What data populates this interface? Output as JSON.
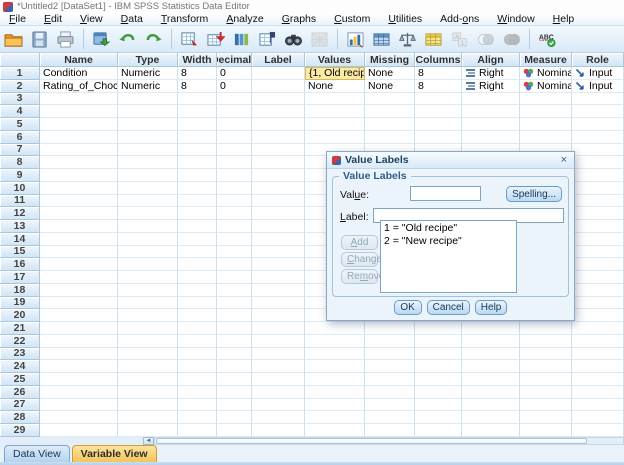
{
  "window": {
    "title": "*Untitled2 [DataSet1] - IBM SPSS Statistics Data Editor"
  },
  "menu": {
    "items": [
      {
        "label": "File",
        "underline": 0
      },
      {
        "label": "Edit",
        "underline": 0
      },
      {
        "label": "View",
        "underline": 0
      },
      {
        "label": "Data",
        "underline": 0
      },
      {
        "label": "Transform",
        "underline": 0
      },
      {
        "label": "Analyze",
        "underline": 0
      },
      {
        "label": "Graphs",
        "underline": 0
      },
      {
        "label": "Custom",
        "underline": 0
      },
      {
        "label": "Utilities",
        "underline": 0
      },
      {
        "label": "Add-ons",
        "underline": 4
      },
      {
        "label": "Window",
        "underline": 0
      },
      {
        "label": "Help",
        "underline": 0
      }
    ]
  },
  "toolbar": {
    "icons": [
      {
        "name": "open-data-icon",
        "disabled": false
      },
      {
        "name": "save-icon",
        "disabled": false
      },
      {
        "name": "print-icon",
        "disabled": false
      },
      {
        "name": "recall-dialogs-icon",
        "disabled": false
      },
      {
        "name": "undo-icon",
        "disabled": false
      },
      {
        "name": "redo-icon",
        "disabled": false
      },
      {
        "name": "goto-case-icon",
        "disabled": false
      },
      {
        "name": "insert-cases-icon",
        "disabled": false
      },
      {
        "name": "goto-variable-icon",
        "disabled": false
      },
      {
        "name": "insert-variable-icon",
        "disabled": false
      },
      {
        "name": "find-icon",
        "disabled": false
      },
      {
        "name": "split-file-icon",
        "disabled": true
      },
      {
        "name": "chart-builder-icon",
        "disabled": false
      },
      {
        "name": "value-labels-grid-icon",
        "disabled": false
      },
      {
        "name": "weigh-cases-icon",
        "disabled": false
      },
      {
        "name": "select-cases-icon",
        "disabled": false
      },
      {
        "name": "value-labels-toggle-icon",
        "disabled": true
      },
      {
        "name": "use-variable-sets-icon",
        "disabled": true
      },
      {
        "name": "show-all-variables-icon",
        "disabled": true
      },
      {
        "name": "spell-check-icon",
        "disabled": false
      }
    ]
  },
  "grid": {
    "columns": [
      "",
      "Name",
      "Type",
      "Width",
      "Decimals",
      "Label",
      "Values",
      "Missing",
      "Columns",
      "Align",
      "Measure",
      "Role"
    ],
    "row_count": 29,
    "rows": [
      {
        "num": "1",
        "name": "Condition",
        "type": "Numeric",
        "width": "8",
        "decimals": "0",
        "label": "",
        "values": "{1, Old recip...",
        "values_selected": true,
        "missing": "None",
        "columns": "8",
        "align": "Right",
        "measure": "Nominal",
        "role": "Input"
      },
      {
        "num": "2",
        "name": "Rating_of_Chocolate",
        "type": "Numeric",
        "width": "8",
        "decimals": "0",
        "label": "",
        "values": "None",
        "values_selected": false,
        "missing": "None",
        "columns": "8",
        "align": "Right",
        "measure": "Nominal",
        "role": "Input"
      }
    ]
  },
  "dialog": {
    "title": "Value Labels",
    "group_label": "Value Labels",
    "value_label": "Value:",
    "value_underline": 3,
    "label_label": "Label:",
    "label_underline": 0,
    "value_input": "",
    "label_input": "",
    "spelling_button": "Spelling...",
    "add_button": "Add",
    "add_underline": 0,
    "change_button": "Change",
    "change_underline": 0,
    "remove_button": "Remove",
    "remove_underline": 2,
    "list_items": [
      "1 = \"Old recipe\"",
      "2 = \"New recipe\""
    ],
    "ok_button": "OK",
    "cancel_button": "Cancel",
    "help_button": "Help",
    "close_glyph": "×"
  },
  "tabs": {
    "data_view": "Data View",
    "variable_view": "Variable View",
    "active": "Variable View"
  },
  "scrollbar": {
    "left_arrow": "◄"
  },
  "colors": {
    "selected_cell": "#fbe9a4",
    "selected_cell_border": "#d5ba62",
    "active_tab": "#f5c45c",
    "inactive_tab": "#b5d3ec",
    "header_fill": "#d2e5f4",
    "grid_line": "#cde1f0",
    "dialog_bg": "#ecf4fb",
    "button_fill": "#bcd9f0",
    "button_border": "#699bc8"
  }
}
